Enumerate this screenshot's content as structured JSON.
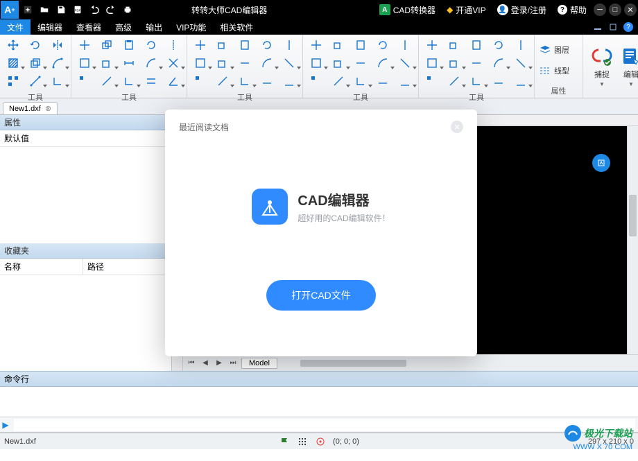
{
  "titlebar": {
    "app_title": "转转大师CAD编辑器",
    "converter": "CAD转换器",
    "vip": "开通VIP",
    "login": "登录/注册",
    "help": "帮助"
  },
  "menu": {
    "items": [
      "文件",
      "编辑器",
      "查看器",
      "高级",
      "输出",
      "VIP功能",
      "相关软件"
    ],
    "active_index": 0
  },
  "ribbon": {
    "group_tool": "工具",
    "group_prop": "属性",
    "prop_layer": "图层",
    "prop_linetype": "线型",
    "big_snap": "捕捉",
    "big_edit": "编辑"
  },
  "doc_tab": {
    "name": "New1.dxf"
  },
  "left": {
    "prop_title": "属性",
    "default": "默认值",
    "fav_title": "收藏夹",
    "col_name": "名称",
    "col_path": "路径"
  },
  "model": {
    "tab": "Model"
  },
  "cmd": {
    "title": "命令行"
  },
  "status": {
    "filename": "New1.dxf",
    "coords": "(0; 0; 0)",
    "dims": "297 x 210 x 0"
  },
  "watermark": {
    "text": "极光下载站",
    "url": "WWW X 70 COM"
  },
  "modal": {
    "recent": "最近阅读文档",
    "brand": "CAD编辑器",
    "subtitle": "超好用的CAD编辑软件！",
    "open_btn": "打开CAD文件"
  }
}
